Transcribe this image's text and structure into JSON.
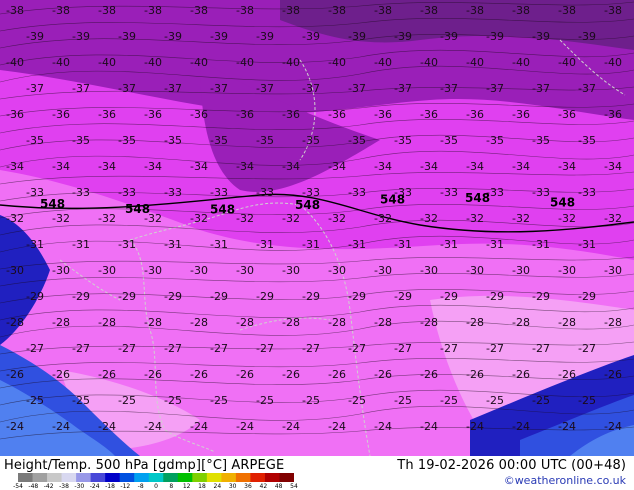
{
  "map": {
    "title": "Height/Temp. 500 hPa [gdmp][°C] ARPEGE",
    "valid_time": "Th 19-02-2026 00:00 UTC (00+48)",
    "credit": "©weatheronline.co.uk",
    "legend": {
      "ticks": [
        "-54",
        "-48",
        "-42",
        "-38",
        "-30",
        "-24",
        "-18",
        "-12",
        "-8",
        "0",
        "8",
        "12",
        "18",
        "24",
        "30",
        "36",
        "42",
        "48",
        "54"
      ],
      "colors": [
        "#7a7a7a",
        "#a0a0a0",
        "#c8c8c8",
        "#d8d8f0",
        "#9898e8",
        "#4848d8",
        "#0000c8",
        "#0050e0",
        "#00a0f0",
        "#00c8c8",
        "#00a060",
        "#00c000",
        "#80d000",
        "#e0e000",
        "#f0b000",
        "#f07000",
        "#e02000",
        "#b00000",
        "#800000"
      ]
    },
    "fill_colors": {
      "deep_purple": "#6e1f8c",
      "purple": "#9a1fb8",
      "magenta": "#cc22dd",
      "bright_magenta": "#e040f0",
      "pink": "#f070f5",
      "light_pink": "#f5a0f5",
      "blue_violet": "#2020c0",
      "blue": "#3050e0",
      "light_blue": "#5080f0"
    },
    "contour_labels": [
      {
        "text": "-38",
        "row": 0
      },
      {
        "text": "-39",
        "row": 1
      },
      {
        "text": "-40",
        "row": 2
      },
      {
        "text": "-37",
        "row": 3
      },
      {
        "text": "-36",
        "row": 4
      },
      {
        "text": "-35",
        "row": 5
      },
      {
        "text": "-34",
        "row": 6
      },
      {
        "text": "-33",
        "row": 7
      },
      {
        "text": "-32",
        "row": 8
      },
      {
        "text": "-31",
        "row": 9
      },
      {
        "text": "-30",
        "row": 10
      },
      {
        "text": "-29",
        "row": 11
      },
      {
        "text": "-28",
        "row": 12
      },
      {
        "text": "-27",
        "row": 13
      },
      {
        "text": "-26",
        "row": 14
      },
      {
        "text": "-25",
        "row": 15
      },
      {
        "text": "-24",
        "row": 16
      }
    ],
    "height_labels": [
      "548",
      "548",
      "548",
      "548",
      "548",
      "548",
      "548"
    ]
  }
}
